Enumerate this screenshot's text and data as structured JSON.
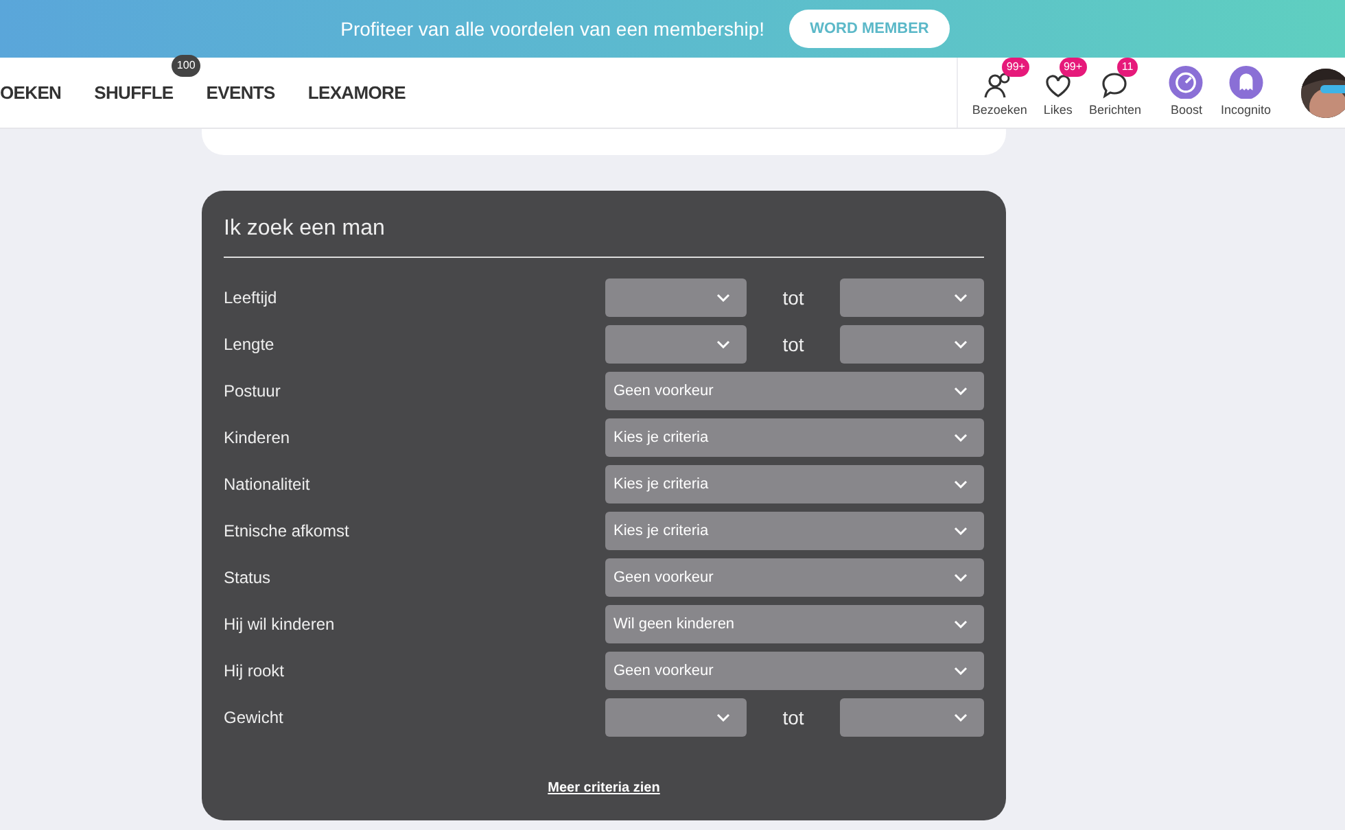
{
  "banner": {
    "text": "Profiteer van alle voordelen van een membership!",
    "button": "WORD MEMBER"
  },
  "nav": {
    "items": [
      {
        "label": "OEKEN"
      },
      {
        "label": "SHUFFLE",
        "badge": "100"
      },
      {
        "label": "EVENTS"
      },
      {
        "label": "LEXAMORE"
      }
    ],
    "actions": [
      {
        "kind": "visits",
        "label": "Bezoeken",
        "badge": "99+"
      },
      {
        "kind": "likes",
        "label": "Likes",
        "badge": "99+"
      },
      {
        "kind": "messages",
        "label": "Berichten",
        "badge": "11"
      },
      {
        "kind": "boost",
        "label": "Boost"
      },
      {
        "kind": "incognito",
        "label": "Incognito"
      }
    ]
  },
  "search": {
    "title": "Ik zoek een man",
    "rows": [
      {
        "kind": "range",
        "label": "Leeftijd",
        "between": "tot"
      },
      {
        "kind": "range",
        "label": "Lengte",
        "between": "tot"
      },
      {
        "kind": "select",
        "label": "Postuur",
        "value": "Geen voorkeur"
      },
      {
        "kind": "select",
        "label": "Kinderen",
        "value": "Kies je criteria"
      },
      {
        "kind": "select",
        "label": "Nationaliteit",
        "value": "Kies je criteria"
      },
      {
        "kind": "select",
        "label": "Etnische afkomst",
        "value": "Kies je criteria"
      },
      {
        "kind": "select",
        "label": "Status",
        "value": "Geen voorkeur"
      },
      {
        "kind": "select",
        "label": "Hij wil kinderen",
        "value": "Wil geen kinderen"
      },
      {
        "kind": "select",
        "label": "Hij rookt",
        "value": "Geen voorkeur"
      },
      {
        "kind": "range",
        "label": "Gewicht",
        "between": "tot"
      }
    ],
    "more_link": "Meer criteria zien"
  }
}
